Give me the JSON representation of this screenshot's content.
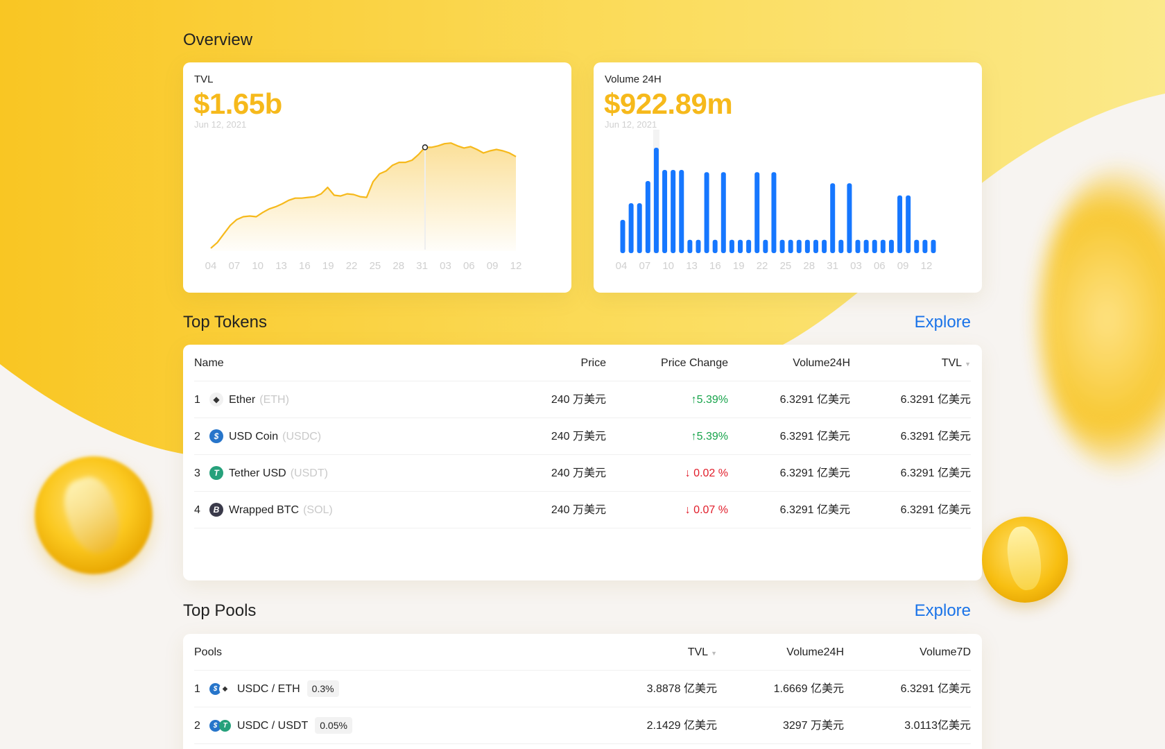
{
  "overview": {
    "title": "Overview"
  },
  "tvl_card": {
    "label": "TVL",
    "value": "$1.65b",
    "date": "Jun 12, 2021"
  },
  "volume_card": {
    "label": "Volume 24H",
    "value": "$922.89m",
    "date": "Jun 12, 2021"
  },
  "chart_data": [
    {
      "type": "area",
      "title": "TVL",
      "x_tick_labels": [
        "04",
        "07",
        "10",
        "13",
        "16",
        "19",
        "22",
        "25",
        "28",
        "31",
        "03",
        "06",
        "09",
        "12"
      ],
      "color": "#f6b91b",
      "series": [
        {
          "values": [
            0.02,
            0.1,
            0.22,
            0.34,
            0.42,
            0.46,
            0.47,
            0.46,
            0.52,
            0.57,
            0.6,
            0.64,
            0.69,
            0.72,
            0.72,
            0.73,
            0.74,
            0.78,
            0.87,
            0.76,
            0.75,
            0.78,
            0.77,
            0.74,
            0.73,
            0.95,
            1.06,
            1.1,
            1.18,
            1.22,
            1.22,
            1.25,
            1.33,
            1.43,
            1.43,
            1.45,
            1.48,
            1.49,
            1.45,
            1.42,
            1.44,
            1.4,
            1.35,
            1.38,
            1.4,
            1.38,
            1.35,
            1.3
          ]
        }
      ],
      "highlight_index": 33
    },
    {
      "type": "bar",
      "title": "Volume 24H",
      "x_tick_labels": [
        "04",
        "07",
        "10",
        "13",
        "16",
        "19",
        "22",
        "25",
        "28",
        "31",
        "03",
        "06",
        "09",
        "12"
      ],
      "color": "#1677ff",
      "series": [
        {
          "values": [
            30,
            45,
            45,
            65,
            95,
            75,
            75,
            75,
            12,
            12,
            73,
            12,
            73,
            12,
            12,
            12,
            73,
            12,
            73,
            12,
            12,
            12,
            12,
            12,
            12,
            63,
            12,
            63,
            12,
            12,
            12,
            12,
            12,
            52,
            52,
            12,
            12,
            12
          ]
        }
      ],
      "highlight_index": 4
    }
  ],
  "top_tokens": {
    "title": "Top Tokens",
    "explore": "Explore",
    "headers": {
      "name": "Name",
      "price": "Price",
      "change": "Price Change",
      "volume": "Volume24H",
      "tvl": "TVL"
    },
    "rows": [
      {
        "rank": "1",
        "icon": "eth-icon",
        "name": "Ether",
        "symbol": "(ETH)",
        "price": "240 万美元",
        "change": "↑5.39%",
        "direction": "up",
        "volume": "6.3291 亿美元",
        "tvl": "6.3291 亿美元"
      },
      {
        "rank": "2",
        "icon": "usdc-icon",
        "name": "USD Coin",
        "symbol": "(USDC)",
        "price": "240 万美元",
        "change": "↑5.39%",
        "direction": "up",
        "volume": "6.3291 亿美元",
        "tvl": "6.3291 亿美元"
      },
      {
        "rank": "3",
        "icon": "usdt-icon",
        "name": "Tether USD",
        "symbol": "(USDT)",
        "price": "240 万美元",
        "change": "↓ 0.02 %",
        "direction": "down",
        "volume": "6.3291 亿美元",
        "tvl": "6.3291 亿美元"
      },
      {
        "rank": "4",
        "icon": "btc-icon",
        "name": "Wrapped BTC",
        "symbol": "(SOL)",
        "price": "240 万美元",
        "change": "↓ 0.07 %",
        "direction": "down",
        "volume": "6.3291 亿美元",
        "tvl": "6.3291 亿美元"
      }
    ]
  },
  "top_pools": {
    "title": "Top Pools",
    "explore": "Explore",
    "headers": {
      "pools": "Pools",
      "tvl": "TVL",
      "volume24": "Volume24H",
      "volume7": "Volume7D"
    },
    "rows": [
      {
        "rank": "1",
        "pair": "USDC / ETH",
        "fee": "0.3%",
        "tvl": "3.8878 亿美元",
        "volume24": "1.6669 亿美元",
        "volume7": "6.3291 亿美元"
      },
      {
        "rank": "2",
        "pair": "USDC / USDT",
        "fee": "0.05%",
        "tvl": "2.1429 亿美元",
        "volume24": "3297 万美元",
        "volume7": "3.0113亿美元"
      }
    ]
  },
  "colors": {
    "accent": "#f6b91b",
    "link": "#1a73e8",
    "up": "#16a34a",
    "down": "#e11d2a",
    "bar": "#1677ff"
  }
}
